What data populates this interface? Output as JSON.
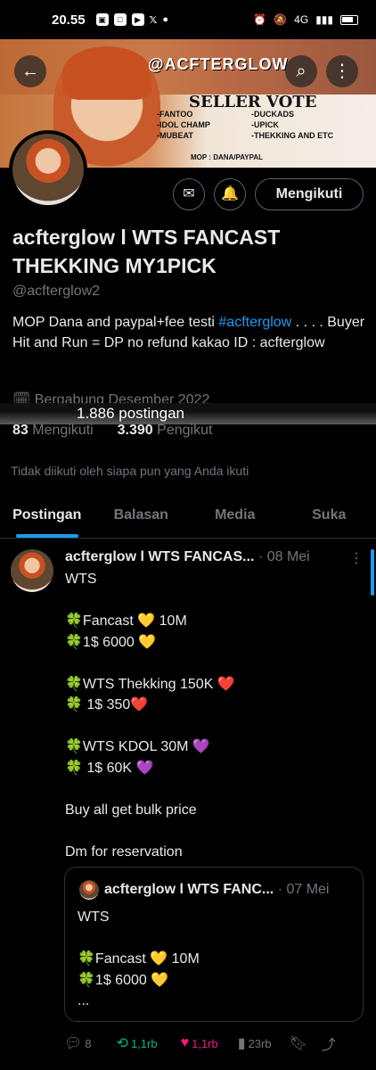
{
  "status_bar": {
    "time": "20.55",
    "app_icons": [
      "shield-app-icon",
      "square-app-icon",
      "youtube-icon",
      "x-icon",
      "dot-icon"
    ],
    "right_icons": [
      "alarm-icon",
      "mute-icon",
      "signal-icon",
      "battery-icon"
    ],
    "network": "4G"
  },
  "banner": {
    "brand": "@ACFTERGLOW",
    "vote_title": "SELLER VOTE",
    "left_list": [
      "-FANTOO",
      "-IDOL CHAMP",
      "-MUBEAT"
    ],
    "right_list": [
      "-DUCKADS",
      "-UPICK",
      "-THEKKING AND ETC"
    ],
    "mop": "MOP : DANA/PAYPAL"
  },
  "nav": {
    "back_icon": "arrow-left-icon",
    "search_icon": "search-icon",
    "more_icon": "more-vertical-icon"
  },
  "profile": {
    "follow_label": "Mengikuti",
    "display_name": "acfterglow l WTS FANCAST THEKKING MY1PICK",
    "handle": "@acfterglow2",
    "bio_pre": "MOP Dana and paypal+fee testi ",
    "bio_tag": "#acfterglow",
    "bio_post": " . . . . Buyer Hit and Run = DP no refund kakao ID : acfterglow",
    "joined": "Bergabung Desember 2022",
    "post_count": "1.886 postingan",
    "following_count": "83",
    "following_label": "Mengikuti",
    "followers_count": "3.390",
    "followers_label": "Pengikut",
    "not_followed_note": "Tidak diikuti oleh siapa pun yang Anda ikuti"
  },
  "tabs": [
    "Postingan",
    "Balasan",
    "Media",
    "Suka"
  ],
  "tweet": {
    "name": "acfterglow l WTS FANCAS...",
    "date": "· 08 Mei",
    "body": "WTS\n\n🍀Fancast 💛 10M\n🍀1$ 6000 💛\n\n🍀WTS Thekking 150K ❤️\n🍀 1$ 350❤️\n\n🍀WTS KDOL  30M  💜\n🍀 1$ 60K 💜\n\nBuy all get bulk price\n\nDm for reservation",
    "quote": {
      "name": "acfterglow l WTS FANC...",
      "date": "· 07 Mei",
      "body": "WTS\n\n🍀Fancast 💛 10M\n🍀1$ 6000 💛\n..."
    },
    "replies": "8",
    "reposts": "1,1rb",
    "likes": "1,1rb",
    "views": "23rb"
  },
  "colors": {
    "accent": "#1d9bf0",
    "repost": "#00ba7c",
    "like": "#f91880",
    "muted": "#71767b",
    "border": "#2f3336"
  }
}
